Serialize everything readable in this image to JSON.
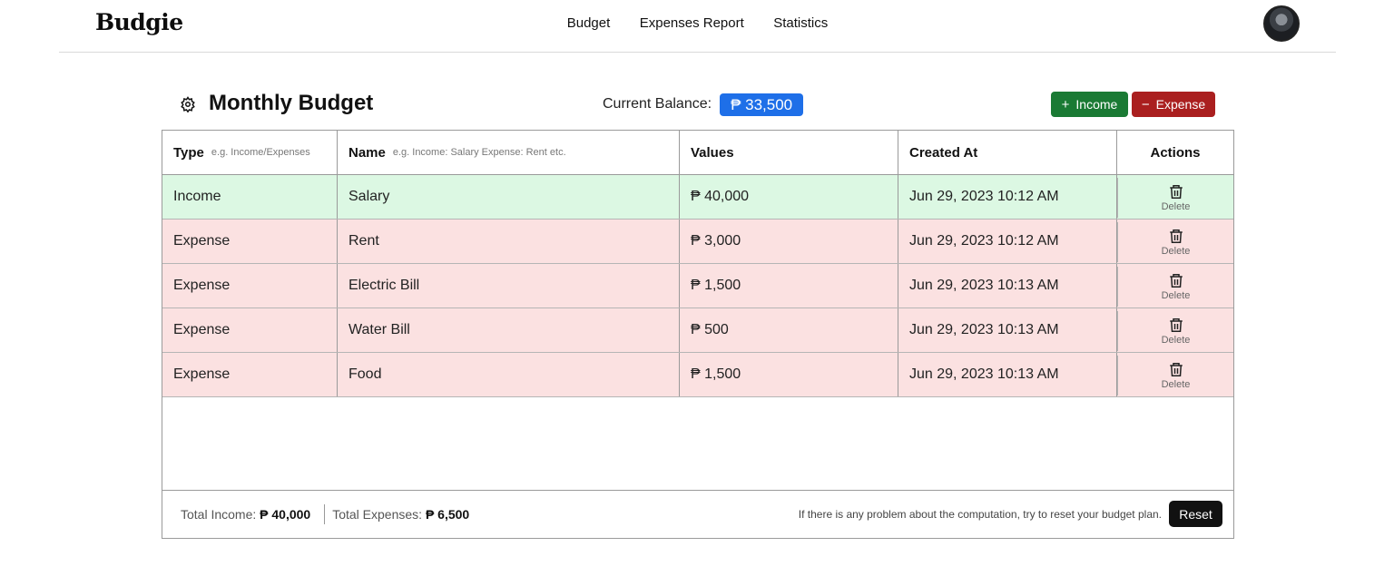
{
  "app": {
    "logo": "Budgie"
  },
  "nav": {
    "items": [
      "Budget",
      "Expenses Report",
      "Statistics"
    ]
  },
  "header": {
    "title": "Monthly Budget",
    "balance_label": "Current Balance:",
    "balance_value": "₱ 33,500",
    "income_button": "Income",
    "expense_button": "Expense"
  },
  "table": {
    "columns": {
      "type": {
        "label": "Type",
        "hint": "e.g. Income/Expenses"
      },
      "name": {
        "label": "Name",
        "hint": "e.g. Income: Salary Expense: Rent etc."
      },
      "values": {
        "label": "Values"
      },
      "created": {
        "label": "Created At"
      },
      "actions": {
        "label": "Actions"
      }
    },
    "rows": [
      {
        "type": "Income",
        "name": "Salary",
        "value": "₱ 40,000",
        "created": "Jun 29, 2023 10:12 AM",
        "action": "Delete"
      },
      {
        "type": "Expense",
        "name": "Rent",
        "value": "₱ 3,000",
        "created": "Jun 29, 2023 10:12 AM",
        "action": "Delete"
      },
      {
        "type": "Expense",
        "name": "Electric Bill",
        "value": "₱ 1,500",
        "created": "Jun 29, 2023 10:13 AM",
        "action": "Delete"
      },
      {
        "type": "Expense",
        "name": "Water Bill",
        "value": "₱ 500",
        "created": "Jun 29, 2023 10:13 AM",
        "action": "Delete"
      },
      {
        "type": "Expense",
        "name": "Food",
        "value": "₱ 1,500",
        "created": "Jun 29, 2023 10:13 AM",
        "action": "Delete"
      }
    ]
  },
  "footer": {
    "income_label": "Total Income:",
    "income_value": "₱ 40,000",
    "expense_label": "Total Expenses:",
    "expense_value": "₱ 6,500",
    "note": "If there is any problem about the computation, try to reset your budget plan.",
    "reset_button": "Reset"
  },
  "colors": {
    "income_row": "#dcf8e3",
    "expense_row": "#fbe1e1",
    "balance_badge": "#1e6fe8",
    "income_button": "#1a7a34",
    "expense_button": "#aa1f1f"
  }
}
